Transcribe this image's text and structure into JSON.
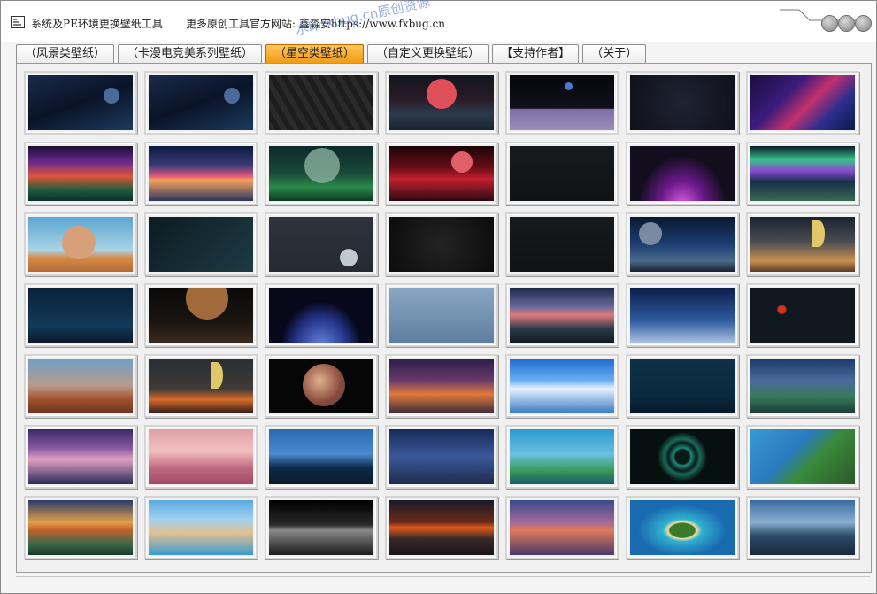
{
  "window": {
    "title": "系统及PE环境更换壁纸工具",
    "website": "更多原创工具官方网站: 鑫淼安https://www.fxbug.cn",
    "watermark": "水印fxbug.cn原创资源"
  },
  "tabs": [
    {
      "label": "（风景类壁纸）",
      "active": false
    },
    {
      "label": "（卡漫电竞美系列壁纸）",
      "active": false
    },
    {
      "label": "（星空类壁纸）",
      "active": true
    },
    {
      "label": "（自定义更换壁纸）",
      "active": false
    },
    {
      "label": "【支持作者】",
      "active": false
    },
    {
      "label": "（关于）",
      "active": false
    }
  ],
  "colors": {
    "active_tab": "#f5a623",
    "panel_bg": "#f0f0f0"
  },
  "wallpapers": [
    {
      "name": "space-blue-planet-light",
      "kind": "space"
    },
    {
      "name": "space-earth-orb",
      "kind": "space"
    },
    {
      "name": "hexagon-dark",
      "kind": "hex"
    },
    {
      "name": "red-planet-road",
      "kind": "red"
    },
    {
      "name": "astronaut-moon-surface",
      "kind": "moon"
    },
    {
      "name": "solar-system-orbits",
      "kind": "orbit"
    },
    {
      "name": "purple-pink-wave",
      "kind": "wave"
    },
    {
      "name": "fantasy-mountains-ring",
      "kind": "fantasy"
    },
    {
      "name": "sunset-clouds-flare",
      "kind": "sunsetcloud"
    },
    {
      "name": "green-planet-jungle",
      "kind": "jungle"
    },
    {
      "name": "red-alien-landscape",
      "kind": "redalien"
    },
    {
      "name": "astronaut-dark",
      "kind": "dark"
    },
    {
      "name": "purple-arc-glow",
      "kind": "arc"
    },
    {
      "name": "aurora-lake",
      "kind": "aurora"
    },
    {
      "name": "planet-desert-sky",
      "kind": "desertplanet"
    },
    {
      "name": "planets-teal",
      "kind": "teal"
    },
    {
      "name": "astronaut-small-moon",
      "kind": "grey"
    },
    {
      "name": "rog-logo-dark",
      "kind": "rog"
    },
    {
      "name": "astronaut-outline",
      "kind": "dark"
    },
    {
      "name": "astronaut-earth-rock",
      "kind": "bluespace"
    },
    {
      "name": "sunset-crescent",
      "kind": "sunsetcres"
    },
    {
      "name": "blue-night-sky",
      "kind": "bluenight"
    },
    {
      "name": "planet-over-rocks",
      "kind": "brownplanet"
    },
    {
      "name": "blue-earth-horizon",
      "kind": "earthhorizon"
    },
    {
      "name": "3d-balls-grey",
      "kind": "balls"
    },
    {
      "name": "pink-cloud-valley",
      "kind": "valley"
    },
    {
      "name": "night-sky-figure",
      "kind": "starrysky"
    },
    {
      "name": "eclipse-dark",
      "kind": "eclipse"
    },
    {
      "name": "desert-moon-rock",
      "kind": "desertrock"
    },
    {
      "name": "orange-dusk-crescent",
      "kind": "dusk"
    },
    {
      "name": "colorful-planet-black",
      "kind": "colorplanet"
    },
    {
      "name": "sunset-horizon",
      "kind": "sunsethorizon"
    },
    {
      "name": "anime-blue-sky",
      "kind": "bluesky"
    },
    {
      "name": "ocean-moonlight",
      "kind": "ocean"
    },
    {
      "name": "fantasy-forest-lake",
      "kind": "forestlake"
    },
    {
      "name": "purple-sunset-shore",
      "kind": "purpleshore"
    },
    {
      "name": "pink-clouds",
      "kind": "pinkclouds"
    },
    {
      "name": "blue-rock-coast",
      "kind": "bluecoast"
    },
    {
      "name": "blue-mountain-lake",
      "kind": "bluemountain"
    },
    {
      "name": "rainbow-island-tower",
      "kind": "rainbow"
    },
    {
      "name": "teal-ring-tunnel",
      "kind": "ring"
    },
    {
      "name": "aerial-green-coast",
      "kind": "greencoast"
    },
    {
      "name": "beach-sunset-rocks",
      "kind": "beach"
    },
    {
      "name": "sandbar-lagoon",
      "kind": "sandbar"
    },
    {
      "name": "black-white-sea",
      "kind": "bw"
    },
    {
      "name": "sunset-sea-stacks",
      "kind": "seastacks"
    },
    {
      "name": "calm-sea-sunset-boat",
      "kind": "calmsea"
    },
    {
      "name": "aerial-island",
      "kind": "island"
    },
    {
      "name": "volcano-cloud-city",
      "kind": "volcano"
    }
  ]
}
